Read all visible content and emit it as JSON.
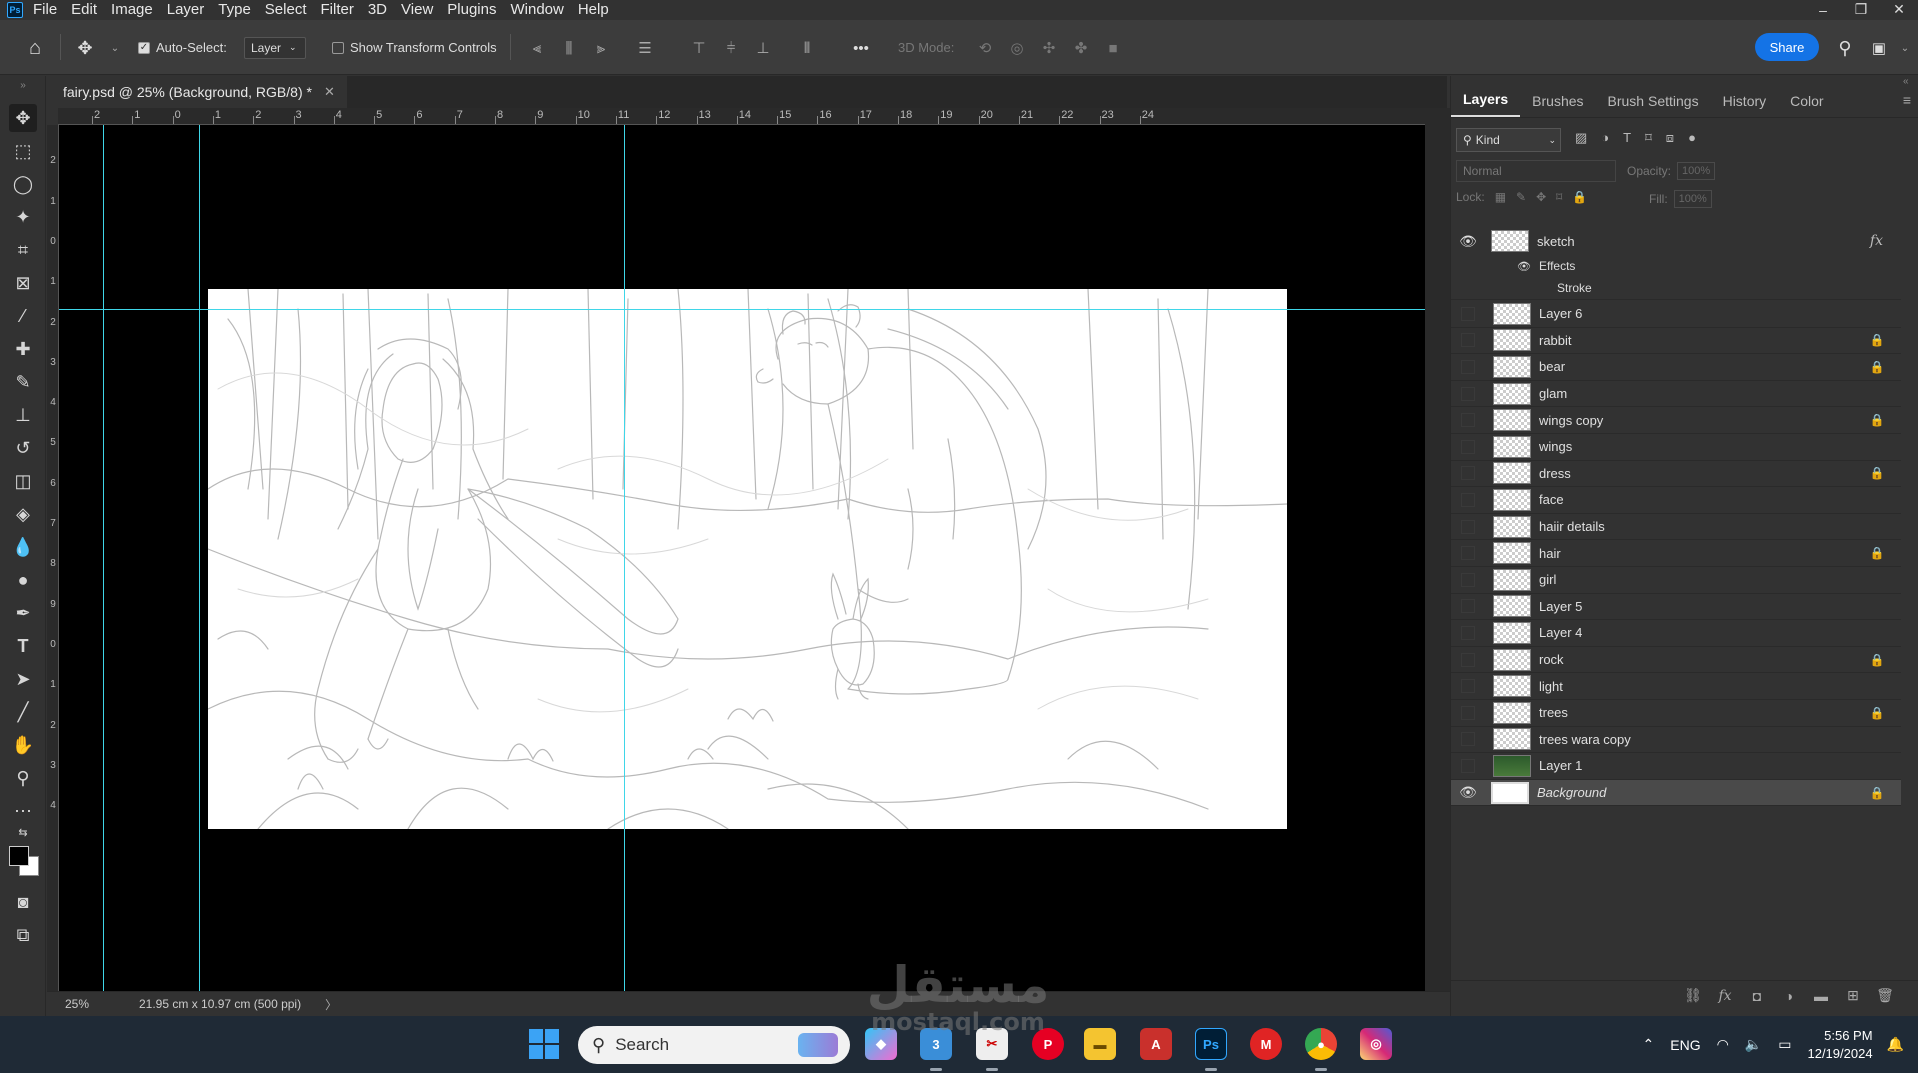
{
  "app": {
    "logo_text": "Ps",
    "menu": [
      "File",
      "Edit",
      "Image",
      "Layer",
      "Type",
      "Select",
      "Filter",
      "3D",
      "View",
      "Plugins",
      "Window",
      "Help"
    ],
    "window_controls": [
      "–",
      "❐",
      "✕"
    ]
  },
  "options_bar": {
    "auto_select_label": "Auto-Select:",
    "auto_select_checked": true,
    "auto_select_target": "Layer",
    "show_transform_label": "Show Transform Controls",
    "more_label": "•••",
    "mode_3d_label": "3D Mode:",
    "share_label": "Share"
  },
  "document": {
    "tab_title": "fairy.psd @ 25% (Background, RGB/8) *",
    "close_glyph": "✕"
  },
  "rulers": {
    "top_labels": [
      "2",
      "1",
      "0",
      "1",
      "2",
      "3",
      "4",
      "5",
      "6",
      "7",
      "8",
      "9",
      "10",
      "11",
      "12",
      "13",
      "14",
      "15",
      "16",
      "17",
      "18",
      "19",
      "20",
      "21",
      "22",
      "23",
      "24"
    ],
    "left_labels": [
      "3",
      "2",
      "1",
      "0",
      "1",
      "2",
      "3",
      "4",
      "5",
      "6",
      "7",
      "8",
      "9",
      "0",
      "1",
      "2",
      "3",
      "4"
    ]
  },
  "status_bar": {
    "zoom": "25%",
    "doc_info": "21.95 cm x 10.97 cm (500 ppi)",
    "arrow": "〉"
  },
  "panel": {
    "tabs": [
      "Layers",
      "Brushes",
      "Brush Settings",
      "History",
      "Color"
    ],
    "active_tab": "Layers",
    "filter_kind": "Kind",
    "blend_mode": "Normal",
    "opacity_label": "Opacity:",
    "opacity_value": "100%",
    "lock_label": "Lock:",
    "fill_label": "Fill:",
    "fill_value": "100%",
    "effects_label": "Effects",
    "stroke_label": "Stroke",
    "fx_label": "fx",
    "layers": [
      {
        "name": "sketch",
        "visible": true,
        "locked": false,
        "fx": true,
        "thumb": "checker"
      },
      {
        "name": "Layer 6",
        "visible": false,
        "locked": false,
        "thumb": "checker"
      },
      {
        "name": "rabbit",
        "visible": false,
        "locked": true,
        "thumb": "checker"
      },
      {
        "name": "bear",
        "visible": false,
        "locked": true,
        "thumb": "checker"
      },
      {
        "name": "glam",
        "visible": false,
        "locked": false,
        "thumb": "checker"
      },
      {
        "name": "wings copy",
        "visible": false,
        "locked": true,
        "thumb": "checker"
      },
      {
        "name": "wings",
        "visible": false,
        "locked": false,
        "thumb": "checker"
      },
      {
        "name": "dress",
        "visible": false,
        "locked": true,
        "thumb": "checker"
      },
      {
        "name": "face",
        "visible": false,
        "locked": false,
        "thumb": "checker"
      },
      {
        "name": "haiir details",
        "visible": false,
        "locked": false,
        "thumb": "checker"
      },
      {
        "name": "hair",
        "visible": false,
        "locked": true,
        "thumb": "checker"
      },
      {
        "name": "girl",
        "visible": false,
        "locked": false,
        "thumb": "checker"
      },
      {
        "name": "Layer 5",
        "visible": false,
        "locked": false,
        "thumb": "checker"
      },
      {
        "name": "Layer 4",
        "visible": false,
        "locked": false,
        "thumb": "checker"
      },
      {
        "name": "rock",
        "visible": false,
        "locked": true,
        "thumb": "checker"
      },
      {
        "name": "light",
        "visible": false,
        "locked": false,
        "thumb": "checker"
      },
      {
        "name": "trees",
        "visible": false,
        "locked": true,
        "thumb": "checker"
      },
      {
        "name": "trees wara copy",
        "visible": false,
        "locked": false,
        "thumb": "checker"
      },
      {
        "name": "Layer 1",
        "visible": false,
        "locked": false,
        "thumb": "green"
      },
      {
        "name": "Background",
        "visible": true,
        "locked": true,
        "thumb": "white",
        "selected": true,
        "italic": true
      }
    ]
  },
  "taskbar": {
    "search_placeholder": "Search",
    "language": "ENG",
    "time": "5:56 PM",
    "date": "12/19/2024"
  },
  "watermark": {
    "arabic": "مستقل",
    "latin": "mostaql.com"
  },
  "colors": {
    "accent": "#1473e6",
    "guide": "#3fd6e8"
  }
}
